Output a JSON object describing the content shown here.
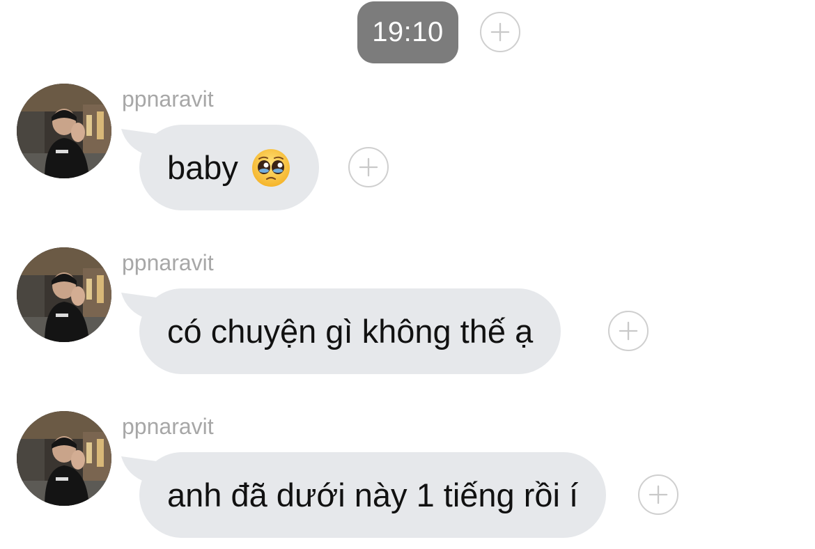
{
  "timestamp": {
    "label": "19:10"
  },
  "messages": [
    {
      "sender": "ppnaravit",
      "text": "baby",
      "emoji": "pleading-face-icon"
    },
    {
      "sender": "ppnaravit",
      "text": "có chuyện gì không thế ạ"
    },
    {
      "sender": "ppnaravit",
      "text": "anh đã dưới này 1 tiếng rồi í"
    }
  ],
  "colors": {
    "bubble": "#e6e8eb",
    "timestamp_pill": "#7c7c7c",
    "username": "#a7a7a7",
    "plus_outline": "#cfcfcf"
  }
}
